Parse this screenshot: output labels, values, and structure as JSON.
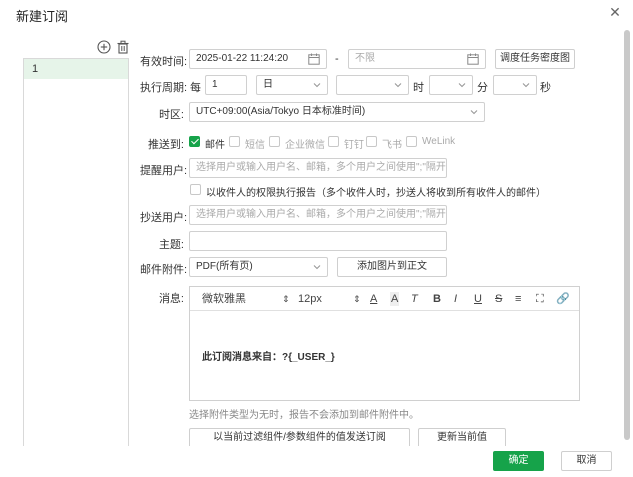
{
  "dialog": {
    "title": "新建订阅"
  },
  "list": {
    "items": [
      "1"
    ]
  },
  "form": {
    "effective_time_label": "有效时间:",
    "start_time": "2025-01-22 11:24:20",
    "range_separator": "-",
    "end_time_placeholder": "不限",
    "schedule_density_button": "调度任务密度图",
    "period_label": "执行周期:",
    "period_prefix": "每",
    "period_value": "1",
    "period_unit": "日",
    "hour_label": "时",
    "minute_label": "分",
    "second_label": "秒",
    "timezone_label": "时区:",
    "timezone_value": "UTC+09:00(Asia/Tokyo 日本标准时间)",
    "push_label": "推送到:",
    "channels": [
      {
        "label": "邮件",
        "checked": true
      },
      {
        "label": "短信",
        "checked": false
      },
      {
        "label": "企业微信",
        "checked": false
      },
      {
        "label": "钉钉",
        "checked": false
      },
      {
        "label": "飞书",
        "checked": false
      },
      {
        "label": "WeLink",
        "checked": false
      }
    ],
    "remind_label": "提醒用户:",
    "remind_placeholder": "选择用户或输入用户名、邮箱，多个用户之间使用\";\"隔开",
    "permission_checkbox_label": "以收件人的权限执行报告（多个收件人时，抄送人将收到所有收件人的邮件）",
    "cc_label": "抄送用户:",
    "cc_placeholder": "选择用户或输入用户名、邮箱，多个用户之间使用\";\"隔开",
    "subject_label": "主题:",
    "subject_value": "",
    "attachment_label": "邮件附件:",
    "attachment_value": "PDF(所有页)",
    "add_image_button": "添加图片到正文",
    "message_label": "消息:",
    "editor": {
      "font_family": "微软雅黑",
      "font_size": "12px",
      "body": "此订阅消息来自：?{_USER_}"
    },
    "hint": "选择附件类型为无时，报告不会添加到邮件附件中。",
    "send_filter_button": "以当前过滤组件/参数组件的值发送订阅",
    "update_current_button": "更新当前值"
  },
  "footer": {
    "ok": "确定",
    "cancel": "取消"
  },
  "colors": {
    "accent": "#16a34a",
    "selected_row": "#e6f4e9"
  }
}
